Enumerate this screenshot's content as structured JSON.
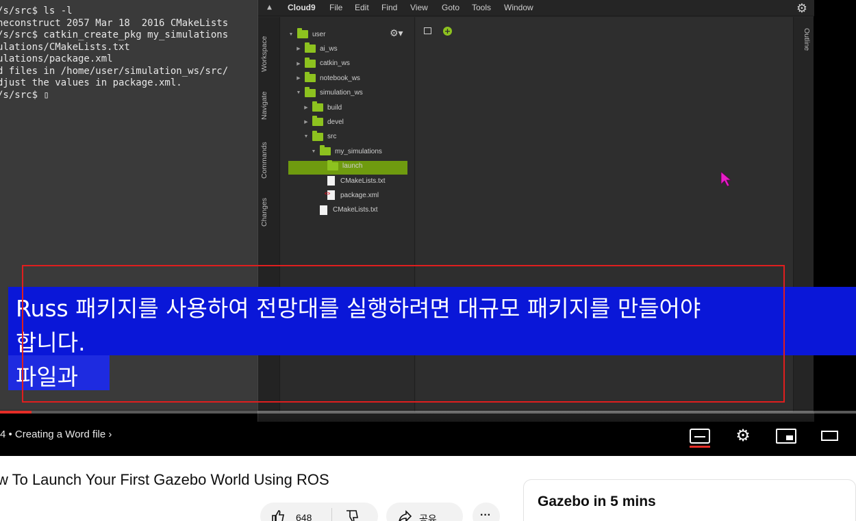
{
  "terminal": {
    "lines": [
      "/s/src$ ls -l",
      "",
      "heconstruct 2057 Mar 18  2016 CMakeLists",
      "/s/src$ catkin_create_pkg my_simulations",
      "ulations/CMakeLists.txt",
      "ulations/package.xml",
      "d files in /home/user/simulation_ws/src/",
      "djust the values in package.xml.",
      "/s/src$ ▯"
    ]
  },
  "cloud9": {
    "menu": [
      "Cloud9",
      "File",
      "Edit",
      "Find",
      "View",
      "Goto",
      "Tools",
      "Window"
    ],
    "side_tabs": [
      "Workspace",
      "Navigate",
      "Commands",
      "Changes"
    ],
    "right_tab": "Outline",
    "tree": [
      {
        "label": "user",
        "type": "folder",
        "indent": 0,
        "open": true
      },
      {
        "label": "ai_ws",
        "type": "folder",
        "indent": 1,
        "open": false
      },
      {
        "label": "catkin_ws",
        "type": "folder",
        "indent": 1,
        "open": false
      },
      {
        "label": "notebook_ws",
        "type": "folder",
        "indent": 1,
        "open": false
      },
      {
        "label": "simulation_ws",
        "type": "folder",
        "indent": 1,
        "open": true
      },
      {
        "label": "build",
        "type": "folder",
        "indent": 2,
        "open": false
      },
      {
        "label": "devel",
        "type": "folder",
        "indent": 2,
        "open": false
      },
      {
        "label": "src",
        "type": "folder",
        "indent": 2,
        "open": true
      },
      {
        "label": "my_simulations",
        "type": "folder",
        "indent": 3,
        "open": true
      },
      {
        "label": "launch",
        "type": "folder",
        "indent": 4,
        "selected": true
      },
      {
        "label": "CMakeLists.txt",
        "type": "file",
        "indent": 4
      },
      {
        "label": "package.xml",
        "type": "xml",
        "indent": 4
      },
      {
        "label": "CMakeLists.txt",
        "type": "file",
        "indent": 3
      }
    ]
  },
  "subtitles": {
    "line1": "Russ 패키지를 사용하여 전망대를 실행하려면 대규모 패키지를 만들어야",
    "line2": "합니다.",
    "line3": "파일과"
  },
  "player": {
    "chapter": "4 • Creating a Word file ›",
    "progress": 0.037,
    "icons": [
      "subtitles-icon",
      "settings-gear-icon",
      "miniplayer-icon",
      "theater-mode-icon"
    ]
  },
  "below": {
    "video_title": "w To Launch Your First Gazebo World Using ROS",
    "like_count": "648",
    "share_label": "공유",
    "side_card_title": "Gazebo in 5 mins"
  },
  "colors": {
    "accent_red": "#e52d27",
    "c9_green": "#8dc21f",
    "subtitle_bg": "#0a17d8"
  }
}
